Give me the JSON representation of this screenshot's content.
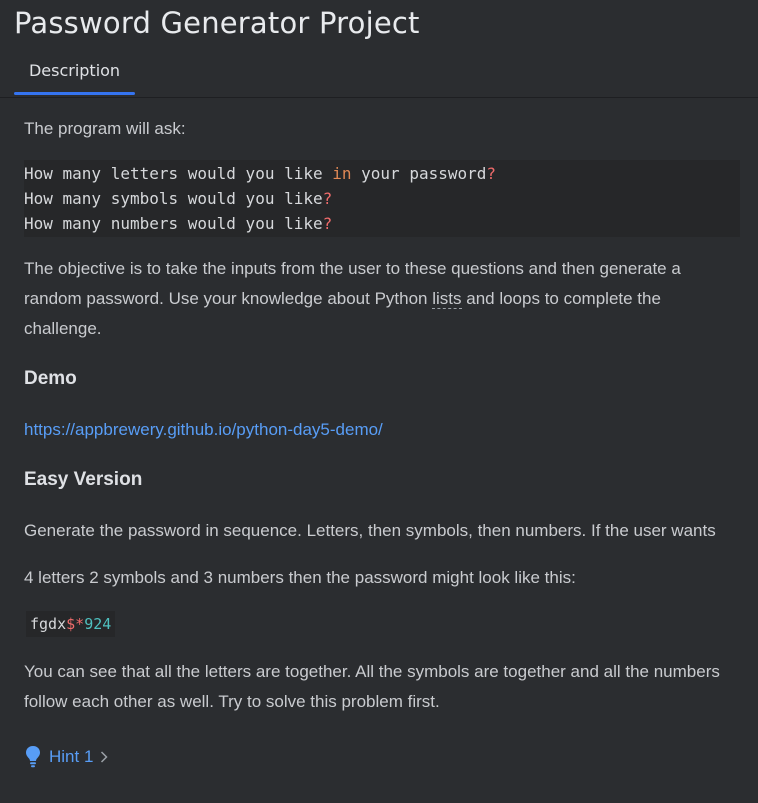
{
  "page": {
    "title": "Password Generator Project"
  },
  "tabs": [
    {
      "label": "Description",
      "active": true
    }
  ],
  "description": {
    "intro": "The program will ask:",
    "code_lines": [
      {
        "before": "How many letters would you like ",
        "keyword": "in",
        "after": " your password",
        "mark": "?"
      },
      {
        "before": "How many symbols would you like",
        "keyword": "",
        "after": "",
        "mark": "?"
      },
      {
        "before": "How many numbers would you like",
        "keyword": "",
        "after": "",
        "mark": "?"
      }
    ],
    "objective_before": "The objective is to take the inputs from the user to these questions and then generate a random password. Use your knowledge about Python ",
    "objective_link": "lists",
    "objective_after": " and loops to complete the challenge.",
    "demo_heading": "Demo",
    "demo_url": "https://appbrewery.github.io/python-day5-demo/",
    "easy_heading": "Easy Version",
    "easy_line1": "Generate the password in sequence. Letters, then symbols, then numbers. If the user wants",
    "easy_line2": "4 letters 2 symbols and 3 numbers then the password might look like this:",
    "example": {
      "letters": "fgdx",
      "symbols": "$*",
      "numbers": "924"
    },
    "together": "You can see that all the letters are together. All the symbols are together and all the numbers follow each other as well. Try to solve this problem first."
  },
  "hint": {
    "label": "Hint 1",
    "icon": "lightbulb-icon"
  },
  "colors": {
    "background": "#2b2d30",
    "accent": "#3574f0",
    "link": "#589df6",
    "code_keyword": "#e08855",
    "code_punct": "#ef6b6b",
    "code_number": "#4fc1c0"
  }
}
